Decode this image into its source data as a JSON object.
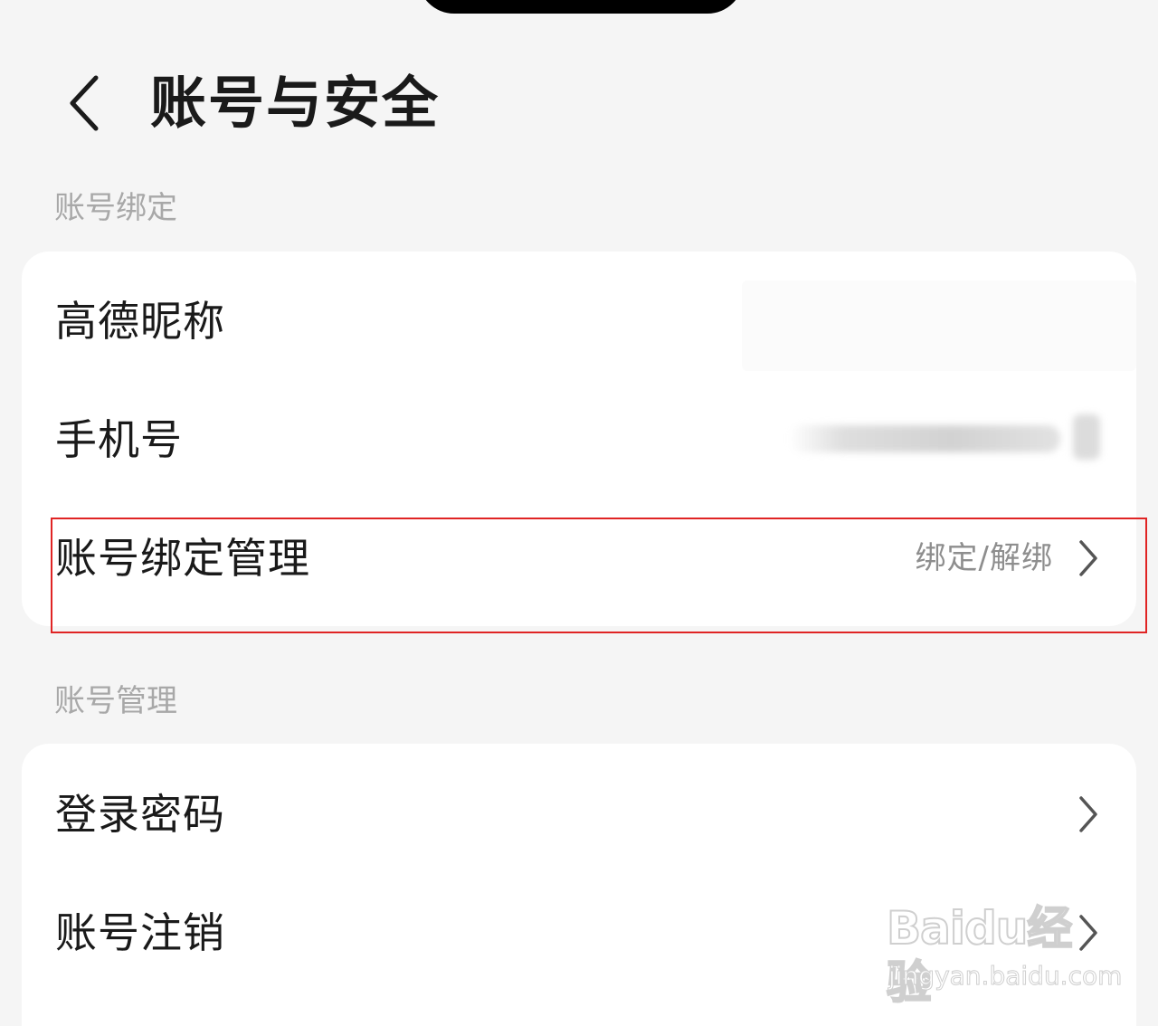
{
  "header": {
    "title": "账号与安全",
    "back_icon": "chevron-left-icon"
  },
  "sections": [
    {
      "label": "账号绑定",
      "items": [
        {
          "label": "高德昵称",
          "value": ""
        },
        {
          "label": "手机号",
          "value": ""
        },
        {
          "label": "账号绑定管理",
          "value": "绑定/解绑"
        }
      ]
    },
    {
      "label": "账号管理",
      "items": [
        {
          "label": "登录密码",
          "value": ""
        },
        {
          "label": "账号注销",
          "value": ""
        }
      ]
    }
  ],
  "highlight_color": "#e02424",
  "watermark": {
    "logo": "Baidu经验",
    "url": "jingyan.baidu.com"
  }
}
